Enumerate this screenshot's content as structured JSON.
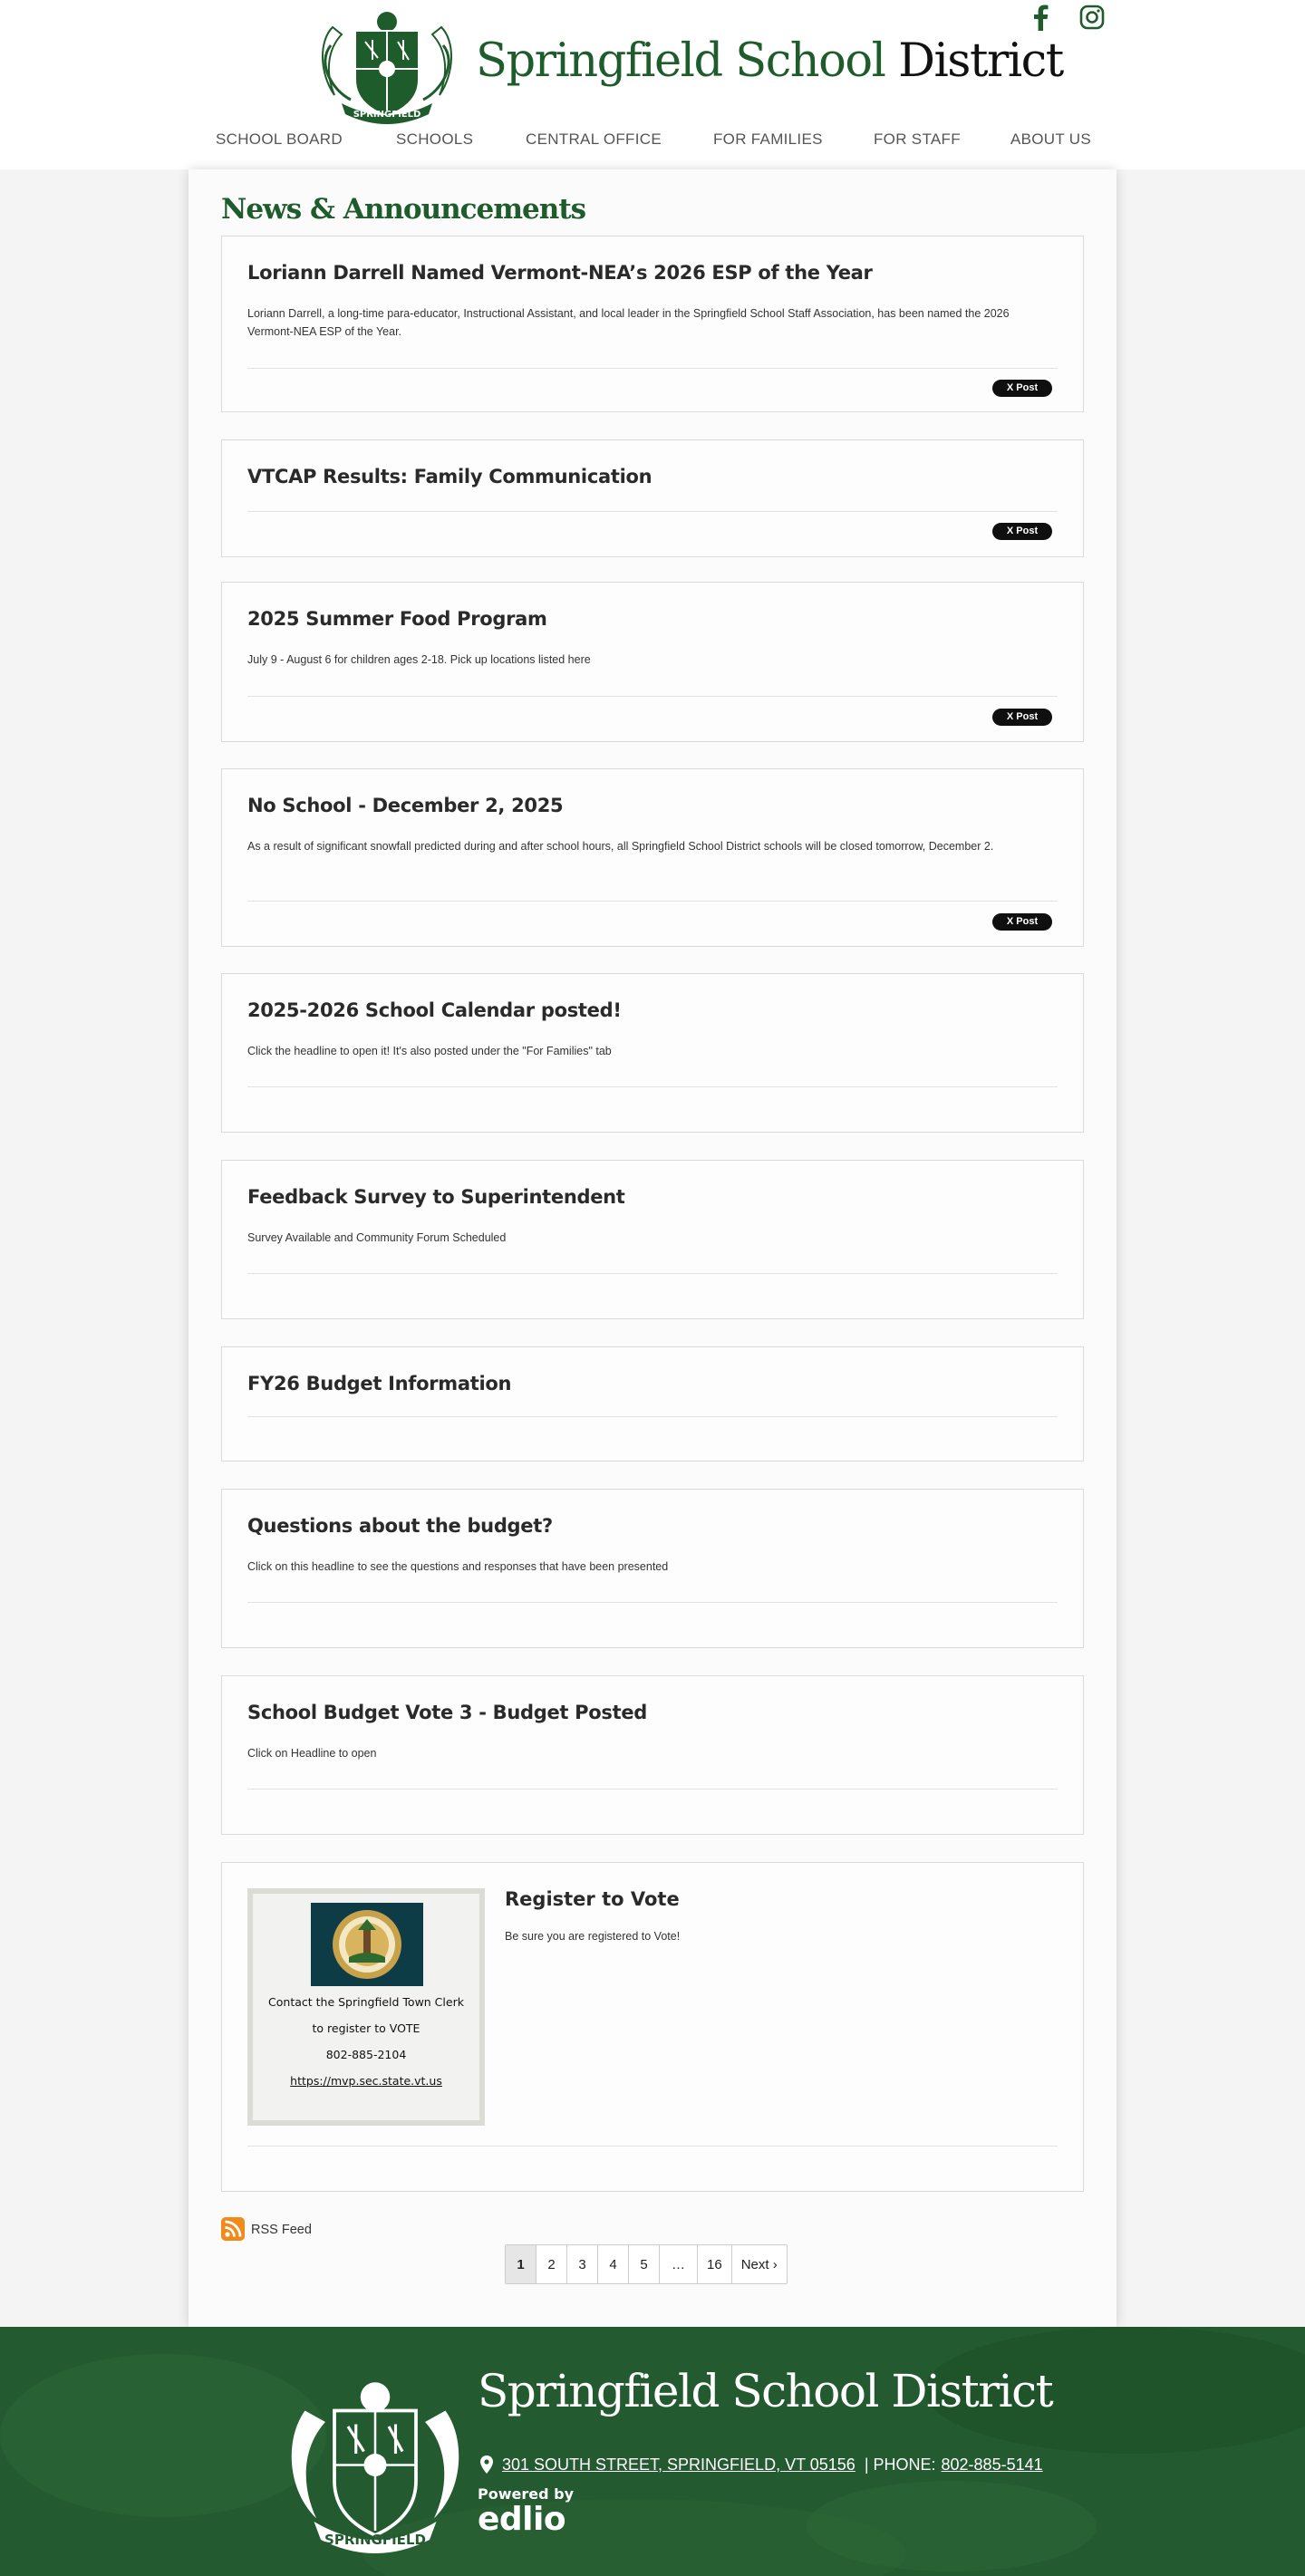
{
  "site": {
    "title_part1": "Springfield School",
    "title_part2": "District"
  },
  "social": {
    "facebook_icon": "facebook-icon",
    "instagram_icon": "instagram-icon"
  },
  "nav": {
    "items": [
      "SCHOOL BOARD",
      "SCHOOLS",
      "CENTRAL OFFICE",
      "FOR FAMILIES",
      "FOR STAFF",
      "ABOUT US"
    ]
  },
  "news": {
    "heading": "News & Announcements",
    "items": [
      {
        "title": "Loriann Darrell Named Vermont-NEA’s 2026 ESP of the Year",
        "summary": "Loriann Darrell, a long-time para-educator, Instructional Assistant, and local leader in the Springfield School Staff Association, has been named the 2026 Vermont-NEA ESP of the Year.",
        "post_label": "X Post"
      },
      {
        "title": "VTCAP Results: Family Communication",
        "summary": "",
        "post_label": "X Post"
      },
      {
        "title": "2025 Summer Food Program",
        "summary": "July 9 - August 6 for children ages 2-18. Pick up locations listed here",
        "post_label": "X Post"
      },
      {
        "title": "No School - December 2, 2025",
        "summary": "As a result of significant snowfall predicted during and after school hours, all Springfield School District schools will be closed tomorrow, December 2.",
        "post_label": "X Post"
      },
      {
        "title": "2025-2026 School Calendar posted!",
        "summary": "Click the headline to open it! It's also posted under the \"For Families\" tab"
      },
      {
        "title": "Feedback Survey to Superintendent",
        "summary": "Survey Available and Community Forum Scheduled"
      },
      {
        "title": "FY26 Budget Information",
        "summary": ""
      },
      {
        "title": "Questions about the budget?",
        "summary": "Click on this headline to see the questions and responses that have been presented"
      },
      {
        "title": "School Budget Vote 3 - Budget Posted",
        "summary": "Click on Headline to open"
      }
    ],
    "vote": {
      "title": "Register to Vote",
      "summary": "Be sure you are registered to Vote!",
      "image_lines": [
        "Contact the Springfield Town Clerk",
        "to register to VOTE",
        "802-885-2104"
      ],
      "image_link": "https://mvp.sec.state.vt.us"
    }
  },
  "rss": {
    "label": "RSS Feed",
    "icon": "rss-icon"
  },
  "pagination": {
    "pages": [
      "1",
      "2",
      "3",
      "4",
      "5",
      "…",
      "16"
    ],
    "current": "1",
    "next_label": "Next ›"
  },
  "footer": {
    "title": "Springfield School District",
    "address": "301 SOUTH STREET, SPRINGFIELD, VT 05156",
    "phone_label": "| PHONE:",
    "phone": "802-885-5141",
    "powered_by_label": "Powered by",
    "powered_by_brand": "edlio"
  },
  "colors": {
    "brand_green": "#1f5c2c",
    "footer_green": "#245a2f",
    "rss_orange": "#f18a1d"
  }
}
